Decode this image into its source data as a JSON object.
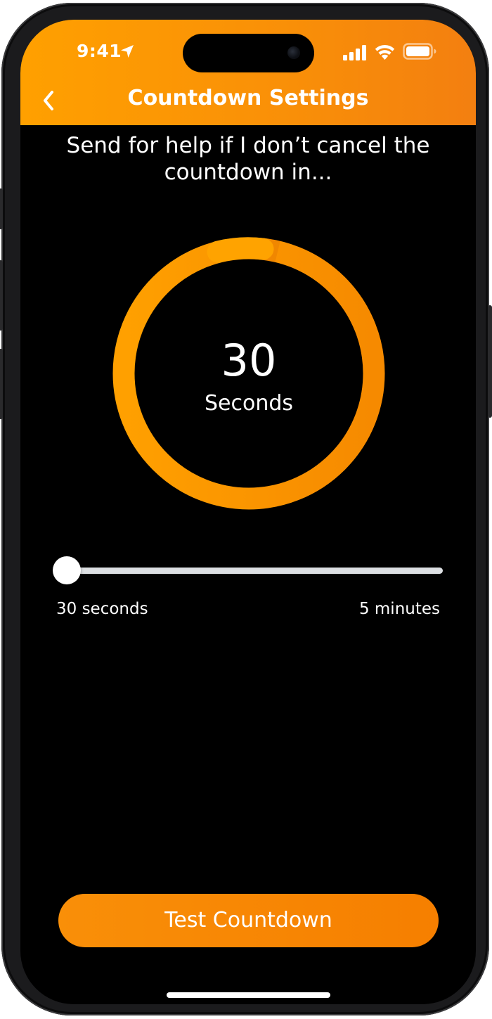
{
  "status_bar": {
    "time": "9:41"
  },
  "header": {
    "title": "Countdown Settings"
  },
  "prompt": {
    "text": "Send for help if I don’t cancel the countdown in..."
  },
  "countdown": {
    "value": "30",
    "unit": "Seconds"
  },
  "slider": {
    "min_label": "30 seconds",
    "max_label": "5 minutes",
    "position_fraction": 0
  },
  "actions": {
    "test_label": "Test Countdown"
  },
  "colors": {
    "accent": "#F98F08",
    "accent_light": "#FFA000",
    "background": "#000000",
    "track": "#DCDFE2"
  },
  "icons": {
    "back": "chevron-left-icon",
    "location": "location-arrow-icon",
    "signal": "cellular-signal-icon",
    "wifi": "wifi-icon",
    "battery": "battery-icon"
  }
}
